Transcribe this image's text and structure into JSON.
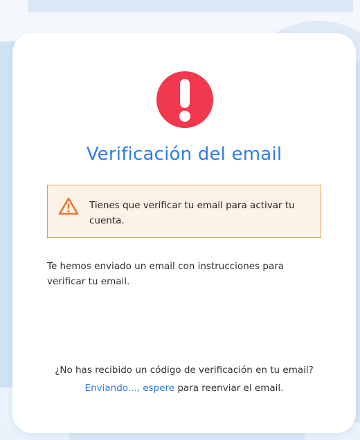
{
  "card": {
    "title": "Verificación del email",
    "warning": {
      "icon": "warning-triangle-icon",
      "text": "Tienes que verificar tu email para activar tu cuenta."
    },
    "info": "Te hemos enviado un email con instrucciones para verificar tu email.",
    "footer": {
      "question": "¿No has recibido un código de verificación en tu email?",
      "resend_link": "Enviando..., espere",
      "resend_suffix": " para reenviar el email."
    }
  },
  "icons": {
    "alert": "exclamation-circle-icon"
  },
  "colors": {
    "accent": "#2d7de6",
    "alert_red": "#f1384f",
    "warning_bg": "#fdf2e7",
    "warning_border": "#e6a056"
  }
}
